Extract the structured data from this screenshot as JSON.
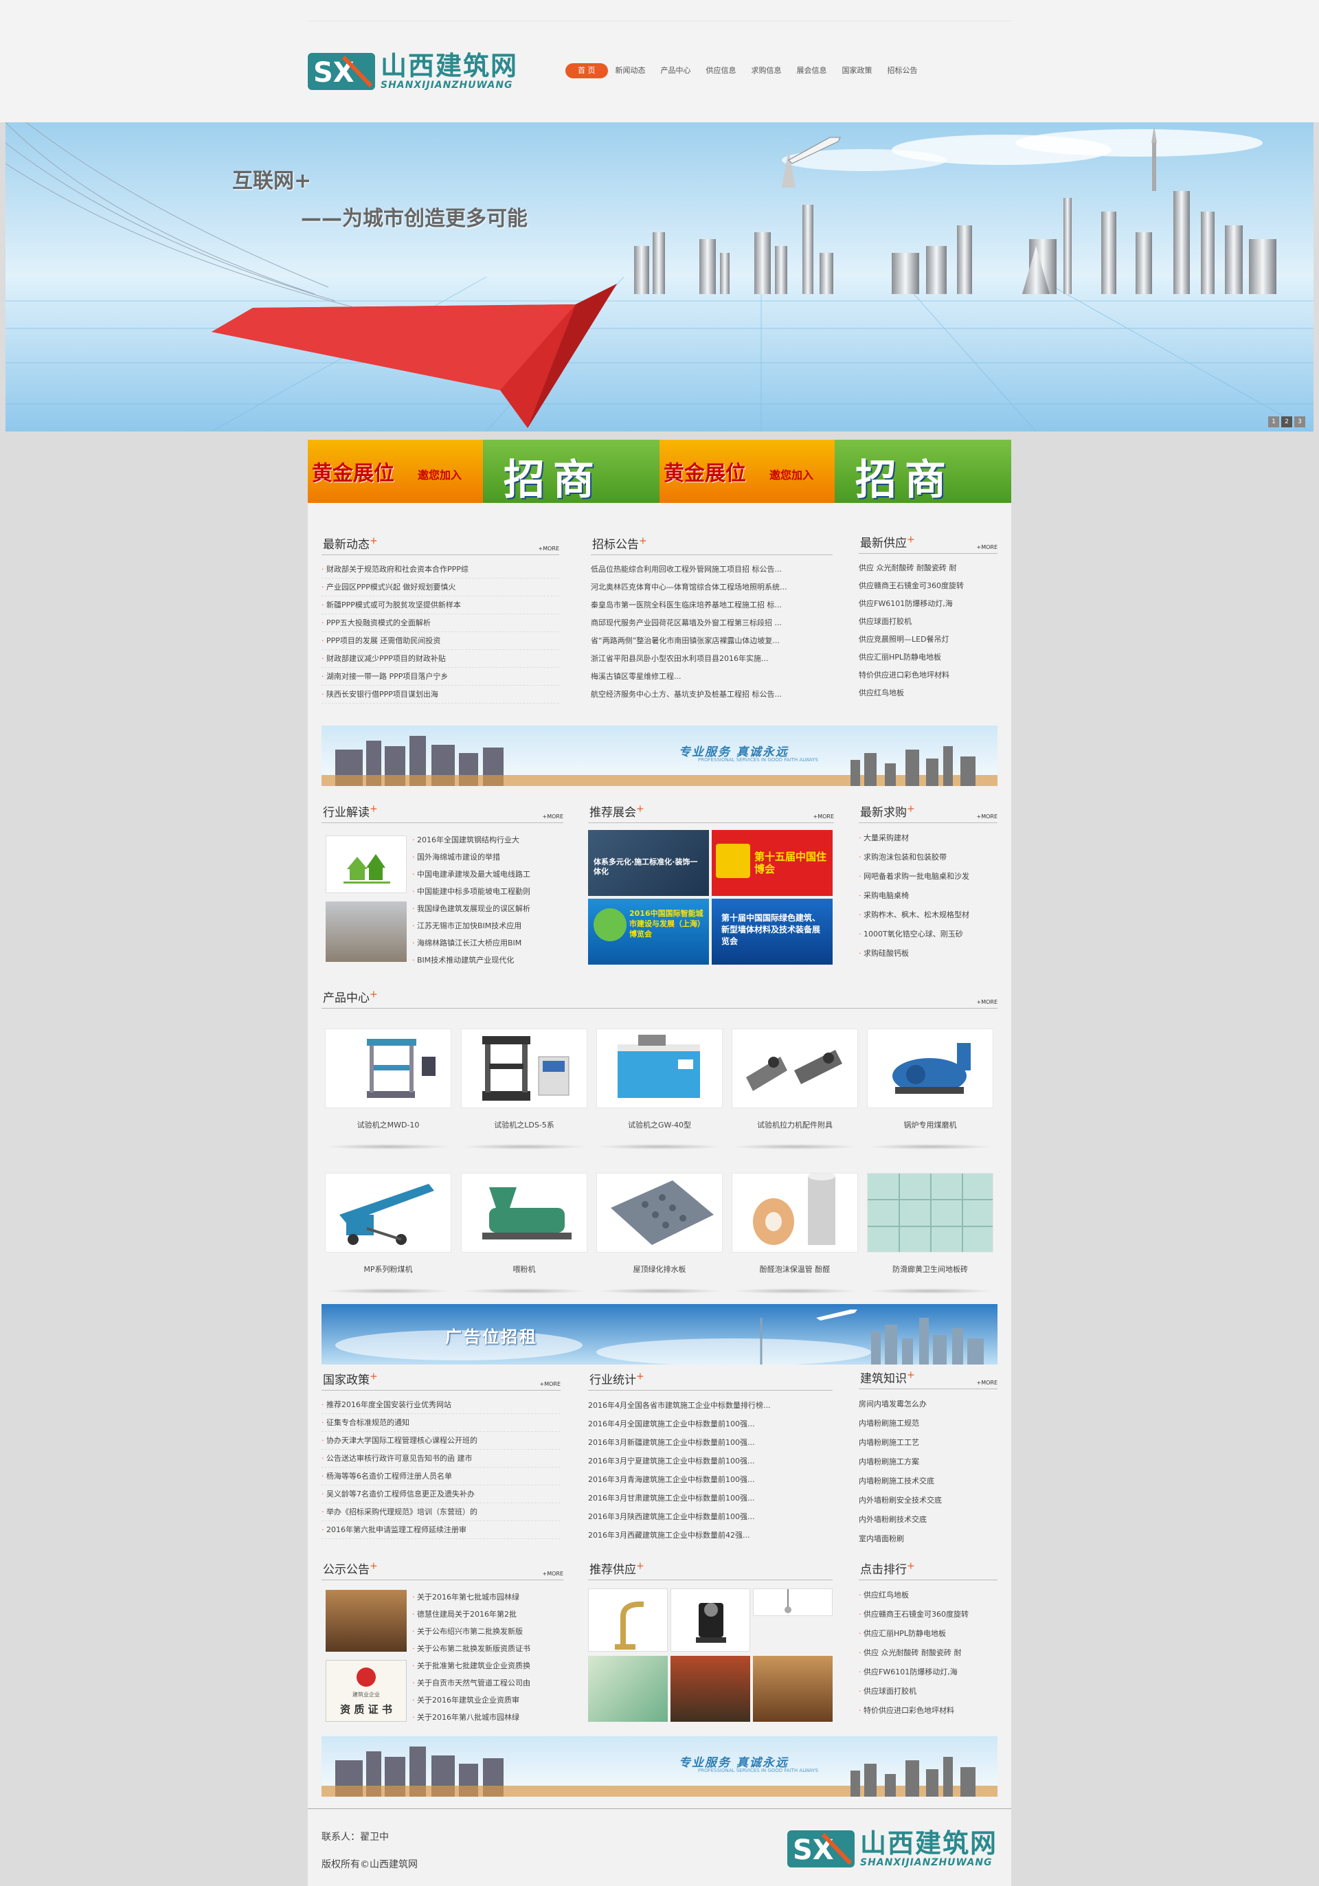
{
  "logo": {
    "cn": "山西建筑网",
    "en": "SHANXIJIANZHUWANG"
  },
  "nav": [
    "首  页",
    "新闻动态",
    "产品中心",
    "供应信息",
    "求购信息",
    "展会信息",
    "国家政策",
    "招标公告"
  ],
  "banner": {
    "line1": "互联网+",
    "line2": "——为城市创造更多可能",
    "dots": [
      "1",
      "2",
      "3"
    ]
  },
  "ads": {
    "gold": "黄金展位",
    "invite": "邀您加入",
    "zs": "招商"
  },
  "wide_banner_text": {
    "main": "专业服务  真诚永远",
    "sub": "PROFESSIONAL SERVICES IN GOOD FAITH ALWAYS"
  },
  "ad_banner_text": "广告位招租",
  "more": "+MORE",
  "news": {
    "title": "最新动态",
    "items": [
      "财政部关于规范政府和社会资本合作PPP综",
      "产业园区PPP模式兴起 做好规划要慎火",
      "新疆PPP模式或可为脱贫攻坚提供新样本",
      "PPP五大投融资模式的全面解析",
      "PPP项目的发展 还需借助民间投资",
      "财政部建议减少PPP项目的财政补贴",
      "湖南对接一带一路 PPP项目落户宁乡",
      "陕西长安银行借PPP项目谋划出海"
    ]
  },
  "bids": {
    "title": "招标公告",
    "items": [
      "低品位热能综合利用回收工程外管网施工项目招 标公告...",
      "河北奥林匹克体育中心—体育馆综合体工程场地照明系统...",
      "秦皇岛市第一医院全科医生临床培养基地工程施工招 标...",
      "商邱现代服务产业园荷花区幕墙及外窗工程第三标段招 ...",
      "省“两路两侧”整治暑化市南田镇张家店裸露山体边坡复...",
      "浙江省平阳县凤卧小型农田水利项目县2016年实施...",
      "梅溪古镇区零星维修工程...",
      "航空经济服务中心土方、基坑支护及桩基工程招 标公告..."
    ]
  },
  "supply": {
    "title": "最新供应",
    "items": [
      "供应 众光耐酸砖 耐酸瓷砖 耐",
      "供应赣商王石镜金可360度旋转",
      "供应FW6101防爆移动灯,海",
      "供应球面打胶机",
      "供应竞晨照明—LED餐吊灯",
      "供应汇丽HPL防静电地板",
      "特价供应进口彩色地坪材料",
      "供应红鸟地板"
    ]
  },
  "analysis": {
    "title": "行业解读",
    "items": [
      "2016年全国建筑钢结构行业大",
      "国外海绵城市建设的举措",
      "中国电建承建埃及最大城电线路工",
      "中国能建中标多项能坡电工程勤则",
      "我国绿色建筑发展现业的误区解析",
      "江苏无锡市正加快BIM技术应用",
      "海绵林路镇江长江大桥应用BIM",
      "BIM技术推动建筑产业现代化"
    ]
  },
  "expo": {
    "title": "推荐展会",
    "tiles": [
      "体系多元化·施工标准化·装饰一体化",
      "第十五届中国住博会",
      "2016中国国际智能城市建设与发展（上海）博览会",
      "第十届中国国际绿色建筑、新型墙体材料及技术装备展览会"
    ]
  },
  "buy": {
    "title": "最新求购",
    "items": [
      "大量采购建材",
      "求购泡沫包装和包装胶带",
      "网吧备着求购一批电脑桌和沙发",
      "采购电脑桌椅",
      "求购柞木、枫木、松木规格型材",
      "1000T氧化锆空心球、刚玉砂",
      "求购硅酸钙板"
    ]
  },
  "products": {
    "title": "产品中心",
    "items": [
      "试验机之MWD-10",
      "试验机之LDS-5系",
      "试验机之GW-40型",
      "试验机拉力机配件附具",
      "锅炉专用煤磨机",
      "MP系列粉煤机",
      "喂粉机",
      "屋顶绿化排水板",
      "酚醛泡沫保温管 酚醛",
      "防滑廊黄卫生间地板砖"
    ]
  },
  "policy": {
    "title": "国家政策",
    "items": [
      "推荐2016年度全国安装行业优秀网站",
      "征集专合标准规范的通知",
      "协办天津大学国际工程管理核心课程公开班的",
      "公告送达审核行政许可意见告知书的函 建市",
      "杨海等等6名造价工程师注册人员名单",
      "吴义龄等7名造价工程师信息更正及遗失补办",
      "举办《招标采购代理规范》培训（东营班）的",
      "2016年第六批申请监理工程师延续注册审"
    ]
  },
  "stats": {
    "title": "行业统计",
    "items": [
      "2016年4月全国各省市建筑施工企业中标数量排行榜...",
      "2016年4月全国建筑施工企业中标数量前100强...",
      "2016年3月新疆建筑施工企业中标数量前100强...",
      "2016年3月宁夏建筑施工企业中标数量前100强...",
      "2016年3月青海建筑施工企业中标数量前100强...",
      "2016年3月甘肃建筑施工企业中标数量前100强...",
      "2016年3月陕西建筑施工企业中标数量前100强...",
      "2016年3月西藏建筑施工企业中标数量前42强..."
    ]
  },
  "knowledge": {
    "title": "建筑知识",
    "items": [
      "房间内墙发霉怎么办",
      "内墙粉刷施工规范",
      "内墙粉刷施工工艺",
      "内墙粉刷施工方案",
      "内墙粉刷施工技术交底",
      "内外墙粉刷安全技术交底",
      "内外墙粉刷技术交底",
      "室内墙面粉刷"
    ]
  },
  "notice": {
    "title": "公示公告",
    "items": [
      "关于2016年第七批城市园林绿",
      "德慧住建局关于2016年第2批",
      "关于公布绍兴市第二批换发新版",
      "关于公布第二批换发新版资质证书",
      "关于批准第七批建筑业企业资质换",
      "关于自贡市天然气管道工程公司由",
      "关于2016年建筑业企业资质审",
      "关于2016年第八批城市园林绿"
    ],
    "cert": "资 质 证 书",
    "cert_small": "建筑业企业"
  },
  "rec_supply": {
    "title": "推荐供应"
  },
  "rank": {
    "title": "点击排行",
    "items": [
      "供应红鸟地板",
      "供应赣商王石镜金可360度旋转",
      "供应汇丽HPL防静电地板",
      "供应 众光耐酸砖 耐酸瓷砖 耐",
      "供应FW6101防爆移动灯,海",
      "供应球面打胶机",
      "特价供应进口彩色地坪材料"
    ]
  },
  "footer": {
    "contact": "联系人：翟卫中",
    "copyright": "版权所有©山西建筑网"
  }
}
